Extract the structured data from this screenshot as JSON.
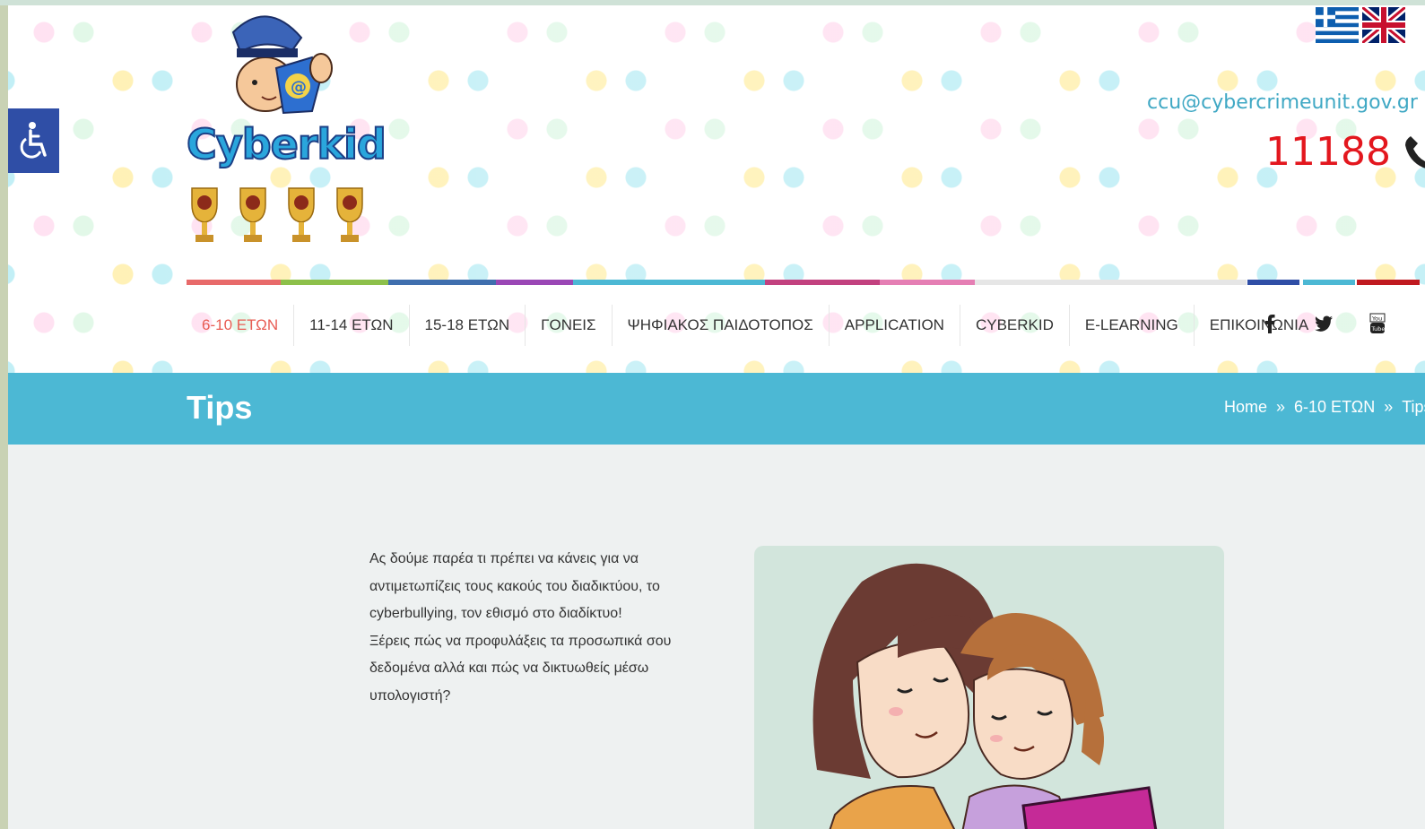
{
  "header": {
    "logo_text": "Cyberkid",
    "contact": {
      "email": "ccu@cybercrimeunit.gov.gr",
      "phone": "11188"
    },
    "languages": [
      "greek-flag-icon",
      "uk-flag-icon"
    ]
  },
  "nav": {
    "items": [
      {
        "label": "6-10 ΕΤΩΝ",
        "active": true
      },
      {
        "label": "11-14 ΕΤΩΝ"
      },
      {
        "label": "15-18 ΕΤΩΝ"
      },
      {
        "label": "ΓΟΝΕΙΣ"
      },
      {
        "label": "ΨΗΦΙΑΚΟΣ ΠΑΙΔΟΤΟΠΟΣ"
      },
      {
        "label": "APPLICATION"
      },
      {
        "label": "CYBERKID"
      },
      {
        "label": "E-LEARNING"
      },
      {
        "label": "ΕΠΙΚΟΙΝΩΝΙΑ"
      }
    ],
    "social": [
      "facebook-icon",
      "twitter-icon",
      "youtube-icon"
    ]
  },
  "titlebar": {
    "title": "Tips",
    "breadcrumb": [
      "Home",
      "6-10 ΕΤΩΝ",
      "Tips"
    ],
    "separator": "»"
  },
  "content": {
    "intro_lines": [
      "Ας δούμε παρέα τι πρέπει να κάνεις για να",
      "αντιμετωπίζεις τους κακούς του διαδικτύου, το",
      "cyberbullying, τον εθισμό στο διαδίκτυο!",
      "Ξέρεις πώς να προφυλάξεις τα προσωπικά σου",
      "δεδομένα αλλά και πώς να δικτυωθείς μέσω",
      "υπολογιστή?"
    ]
  },
  "colors": {
    "accent_red": "#e85c53",
    "titlebar": "#4cb8d4",
    "phone_red": "#e3171e",
    "email_blue": "#3fa8c4"
  }
}
